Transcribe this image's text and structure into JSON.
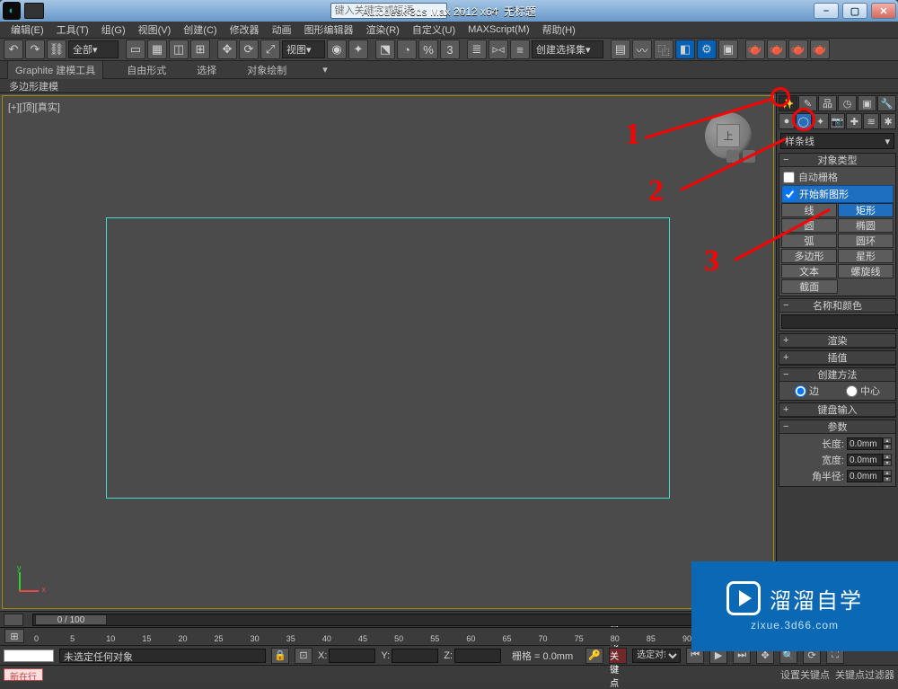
{
  "titlebar": {
    "app_name": "Autodesk 3ds Max 2012 x64",
    "doc_name": "无标题",
    "search_placeholder": "键入关键字或短语"
  },
  "menubar": {
    "items": [
      "编辑(E)",
      "工具(T)",
      "组(G)",
      "视图(V)",
      "创建(C)",
      "修改器",
      "动画",
      "图形编辑器",
      "渲染(R)",
      "自定义(U)",
      "MAXScript(M)",
      "帮助(H)"
    ]
  },
  "toolbar": {
    "layer_dropdown": "全部",
    "view_dropdown": "视图",
    "selection_set": "创建选择集"
  },
  "ribbon": {
    "tabs": [
      "Graphite 建模工具",
      "自由形式",
      "选择",
      "对象绘制"
    ],
    "sub": "多边形建模"
  },
  "viewport": {
    "label": "[+][顶][真实]",
    "cube_face": "上"
  },
  "command_panel": {
    "dropdown": "样条线",
    "rollouts": {
      "object_type": {
        "title": "对象类型",
        "auto_grid": "自动栅格",
        "start_new": "开始新图形",
        "buttons": [
          "线",
          "矩形",
          "圆",
          "椭圆",
          "弧",
          "圆环",
          "多边形",
          "星形",
          "文本",
          "螺旋线",
          "截面"
        ]
      },
      "name_color": {
        "title": "名称和颜色"
      },
      "rendering": {
        "title": "渲染"
      },
      "interpolation": {
        "title": "插值"
      },
      "creation_method": {
        "title": "创建方法",
        "options": [
          "边",
          "中心"
        ]
      },
      "keyboard_entry": {
        "title": "键盘输入"
      },
      "parameters": {
        "title": "参数",
        "rows": [
          {
            "label": "长度:",
            "value": "0.0mm"
          },
          {
            "label": "宽度:",
            "value": "0.0mm"
          },
          {
            "label": "角半径:",
            "value": "0.0mm"
          }
        ]
      }
    }
  },
  "timeline": {
    "slider": "0 / 100",
    "ticks": [
      "0",
      "5",
      "10",
      "15",
      "20",
      "25",
      "30",
      "35",
      "40",
      "45",
      "50",
      "55",
      "60",
      "65",
      "70",
      "75",
      "80",
      "85",
      "90"
    ]
  },
  "statusbar": {
    "message": "未选定任何对象",
    "x": "X:",
    "y": "Y:",
    "z": "Z:",
    "grid": "栅格 = 0.0mm",
    "autokey": "自动关键点",
    "selected": "选定对象"
  },
  "statusbar2": {
    "rec": "新在行",
    "hint1": "设置关键点",
    "hint2": "关键点过滤器"
  },
  "annotations": {
    "n1": "1",
    "n2": "2",
    "n3": "3"
  },
  "watermark": {
    "brand": "溜溜自学",
    "url": "zixue.3d66.com"
  }
}
